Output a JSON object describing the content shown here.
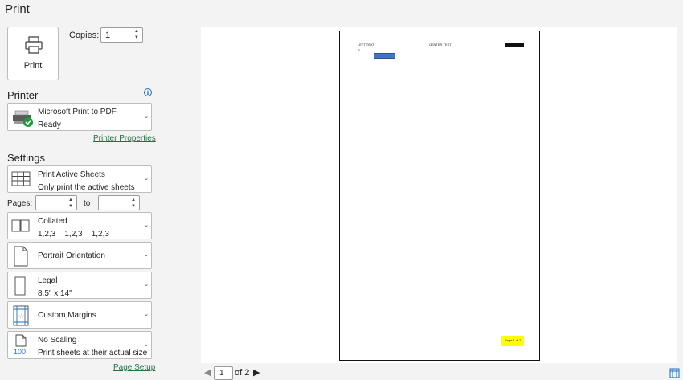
{
  "title": "Print",
  "print_button": {
    "label": "Print",
    "icon": "printer-icon"
  },
  "copies": {
    "label": "Copies:",
    "value": "1"
  },
  "printer": {
    "section_title": "Printer",
    "name": "Microsoft Print to PDF",
    "status": "Ready",
    "properties_link": "Printer Properties"
  },
  "settings": {
    "section_title": "Settings",
    "what": {
      "label": "Print Active Sheets",
      "sub": "Only print the active sheets"
    },
    "pages": {
      "label": "Pages:",
      "from": "",
      "to_label": "to",
      "to": ""
    },
    "collate": {
      "label": "Collated",
      "sub": "1,2,3    1,2,3    1,2,3"
    },
    "orientation": {
      "label": "Portrait Orientation"
    },
    "paper": {
      "label": "Legal",
      "sub": "8.5\" x 14\""
    },
    "margins": {
      "label": "Custom Margins"
    },
    "scaling": {
      "label": "No Scaling",
      "sub": "Print sheets at their actual size",
      "icon_text": "100"
    },
    "page_setup_link": "Page Setup"
  },
  "preview": {
    "header_left": "LEFT TEXT",
    "header_center": "CENTER TEXT",
    "header_right": "RIGHT TEXT",
    "cell_a1": "P",
    "footer": "Page 1 of 2",
    "highlight_color": "#ffff00",
    "cell_fill_color": "#4472c4"
  },
  "navigation": {
    "current_page": "1",
    "total": "of 2"
  },
  "colors": {
    "accent": "#217346",
    "info": "#1e6fc0"
  }
}
